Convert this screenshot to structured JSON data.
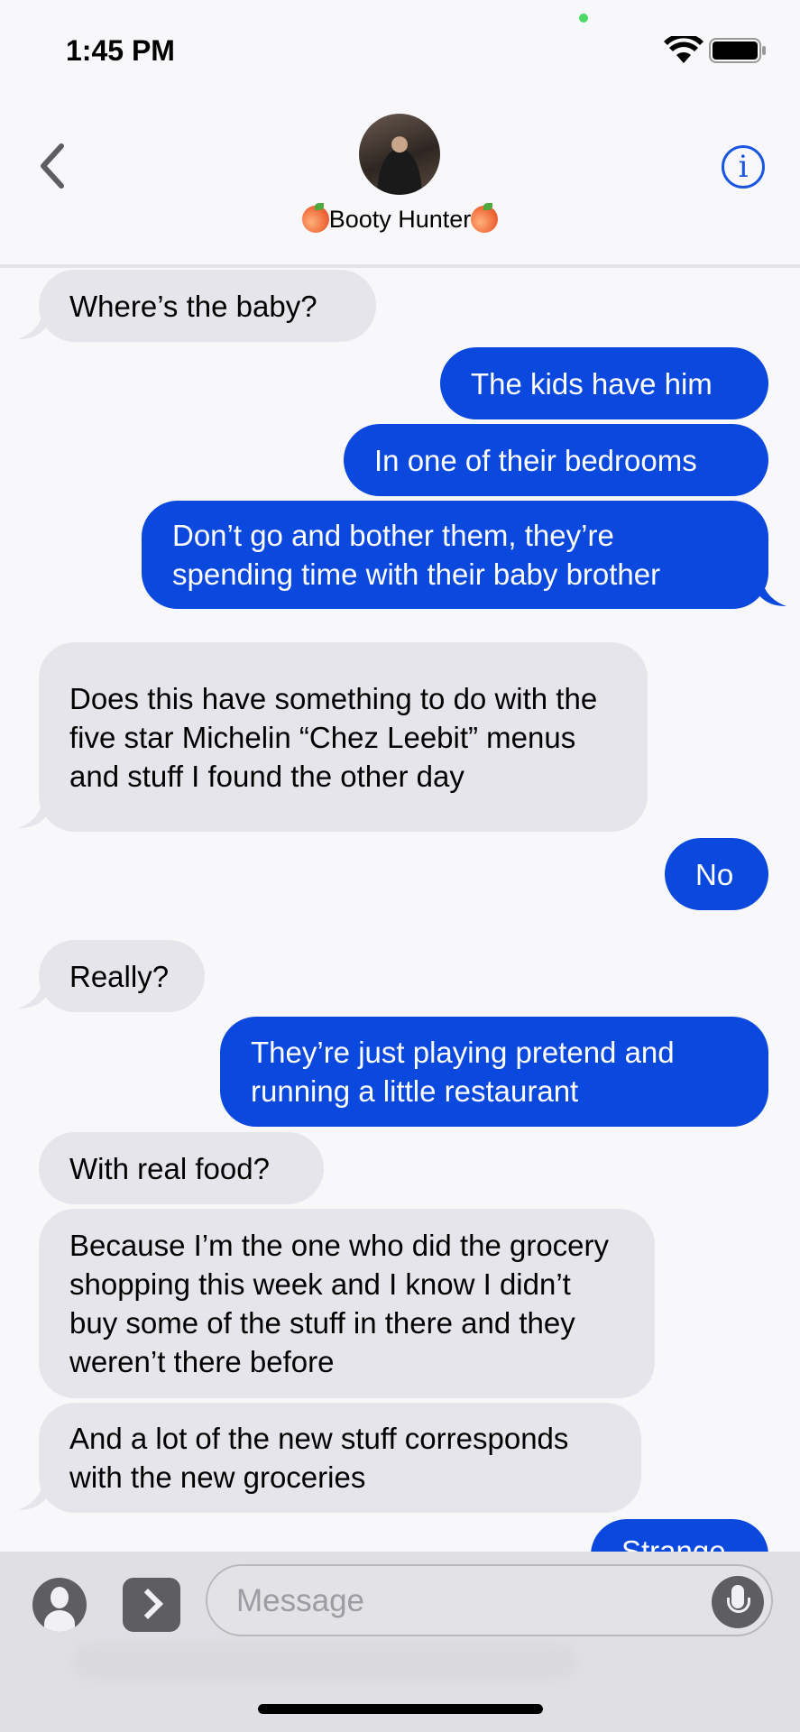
{
  "status_bar": {
    "time": "1:45 PM"
  },
  "header": {
    "contact_name": "Booty Hunter",
    "info_label": "i"
  },
  "messages": [
    {
      "dir": "received",
      "text": "Where’s the baby?"
    },
    {
      "dir": "sent",
      "text": "The kids have him"
    },
    {
      "dir": "sent",
      "text": "In one of their bedrooms"
    },
    {
      "dir": "sent",
      "text": "Don’t go and bother them, they’re spending time with their baby brother"
    },
    {
      "dir": "received",
      "text": "Does this have something to do with the five star Michelin “Chez Leebit” menus and stuff I found the other day"
    },
    {
      "dir": "sent",
      "text": "No"
    },
    {
      "dir": "received",
      "text": "Really?"
    },
    {
      "dir": "sent",
      "text": "They’re just playing pretend and running a little restaurant"
    },
    {
      "dir": "received",
      "text": "With real food?"
    },
    {
      "dir": "received",
      "text": "Because I’m the one who did the grocery shopping this week and I know I didn’t buy some of the stuff in there and they weren’t there before"
    },
    {
      "dir": "received",
      "text": "And a lot of the new stuff corresponds with the new groceries"
    },
    {
      "dir": "sent",
      "text": "Strange"
    }
  ],
  "compose": {
    "placeholder": "Message"
  },
  "colors": {
    "sent_bubble": "#0b48dd",
    "received_bubble": "#e6e5eb",
    "accent": "#1a56e0"
  }
}
